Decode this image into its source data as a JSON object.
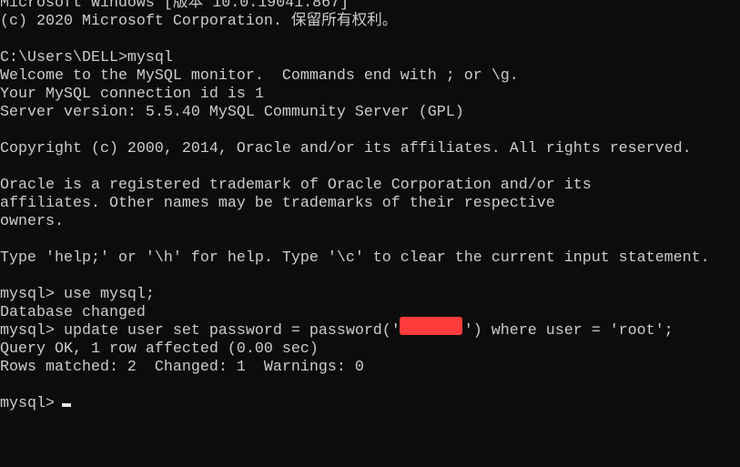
{
  "terminal": {
    "lines": [
      "Microsoft Windows [版本 10.0.19041.867]",
      "(c) 2020 Microsoft Corporation. 保留所有权利。",
      "",
      "C:\\Users\\DELL>mysql",
      "Welcome to the MySQL monitor.  Commands end with ; or \\g.",
      "Your MySQL connection id is 1",
      "Server version: 5.5.40 MySQL Community Server (GPL)",
      "",
      "Copyright (c) 2000, 2014, Oracle and/or its affiliates. All rights reserved.",
      "",
      "Oracle is a registered trademark of Oracle Corporation and/or its",
      "affiliates. Other names may be trademarks of their respective",
      "owners.",
      "",
      "Type 'help;' or '\\h' for help. Type '\\c' to clear the current input statement.",
      "",
      "mysql> use mysql;",
      "Database changed",
      "mysql> update user set password = password('       ') where user = 'root';",
      "Query OK, 1 row affected (0.00 sec)",
      "Rows matched: 2  Changed: 1  Warnings: 0",
      "",
      "mysql> "
    ],
    "colors": {
      "background": "#0c0c0c",
      "text": "#cccccc",
      "redaction": "#ff3b3b"
    }
  }
}
